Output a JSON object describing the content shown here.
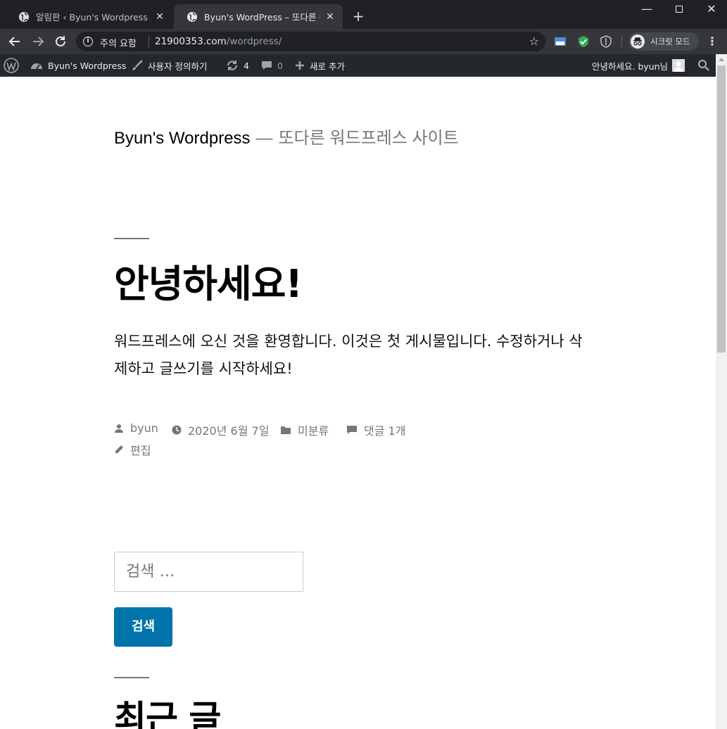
{
  "browser": {
    "tabs": [
      {
        "title": "알림판 ‹ Byun's Wordpress — 워드프레스",
        "active": false
      },
      {
        "title": "Byun's WordPress – 또다른 워드프레스 사이트",
        "active": true
      }
    ],
    "new_tab_label": "+",
    "address": {
      "security_label": "주의 요함",
      "host": "21900353.com",
      "path": "/wordpress/"
    },
    "incognito_label": "시크릿 모드",
    "colors": {
      "frame": "#202124",
      "toolbar": "#35363a"
    }
  },
  "admin_bar": {
    "site_name": "Byun's Wordpress",
    "customize_label": "사용자 정의하기",
    "updates_count": "4",
    "comments_count": "0",
    "new_label": "새로 추가",
    "howdy": "안녕하세요. byun님",
    "colors": {
      "background": "#23282d",
      "text": "#eeeeee"
    }
  },
  "site": {
    "title": "Byun's Wordpress",
    "separator": "—",
    "description": "또다른 워드프레스 사이트"
  },
  "post": {
    "title": "안녕하세요!",
    "body": "워드프레스에 오신 것을 환영합니다. 이것은 첫 게시물입니다. 수정하거나 삭제하고 글쓰기를 시작하세요!",
    "author": "byun",
    "date": "2020년 6월 7일",
    "category": "미분류",
    "comments": "댓글 1개",
    "edit_label": "편집"
  },
  "search_widget": {
    "placeholder": "검색 …",
    "button_label": "검색",
    "button_color": "#0073aa"
  },
  "recent_posts": {
    "heading": "최근 글"
  }
}
